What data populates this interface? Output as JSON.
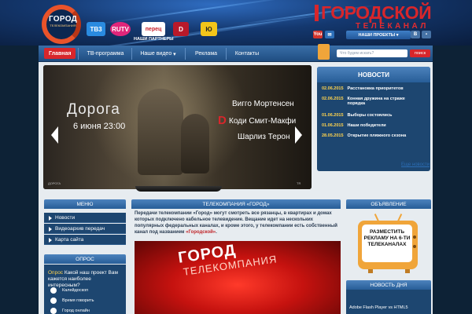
{
  "header": {
    "logo_big": "ГОРОД",
    "logo_small": "ТЕЛЕКОМПАНИЯ",
    "partners_label": "НАШИ ПАРТНЕРЫ",
    "partners": [
      {
        "label": "ТВ3",
        "color": "#2a8be0"
      },
      {
        "label": "RUTV",
        "color": "#e0267a"
      },
      {
        "label": "перец",
        "color": "#c8202a"
      },
      {
        "label": "D",
        "color": "#b8192a"
      },
      {
        "label": "Ю",
        "color": "#f3c51a"
      }
    ],
    "brand_line1": "ГОРОДСКОЙ",
    "brand_line2": "ТЕЛЕКАНАЛ",
    "projects_label": "НАШИ ПРОЕКТЫ",
    "social": [
      {
        "label": "You",
        "color": "#d3342c"
      },
      {
        "label": "✉",
        "color": "#2c6fb8"
      },
      {
        "label": "В",
        "color": "#4773a6"
      }
    ]
  },
  "nav": {
    "items": [
      "Главная",
      "ТВ-программа",
      "Наше видео",
      "Реклама",
      "Контакты"
    ],
    "search_placeholder": "Что будем искать?",
    "search_button": "поиск"
  },
  "slider": {
    "title": "Дорога",
    "date": "6 июня 23:00",
    "letter": "D",
    "cast": [
      "Вигго Мортенсен",
      "Коди Смит-Макфи",
      "Шарлиз Терон"
    ],
    "footer_left": "ДОРОГА",
    "footer_right": "TR"
  },
  "news": {
    "title": "НОВОСТИ",
    "items": [
      {
        "date": "02.06.2015",
        "text": "Расстановка приоритетов"
      },
      {
        "date": "02.06.2015",
        "text": "Конная дружина на страже порядка"
      },
      {
        "date": "01.06.2015",
        "text": "Выборы состоялись"
      },
      {
        "date": "01.06.2015",
        "text": "Наши победители"
      },
      {
        "date": "28.05.2015",
        "text": "Открытие пляжного сезона"
      }
    ],
    "more": "Еще новости"
  },
  "menu": {
    "title": "МЕНЮ",
    "items": [
      "Новости",
      "Видеоархив передач",
      "Карта сайта"
    ]
  },
  "poll": {
    "title": "ОПРОС",
    "label": "Опрос",
    "question": "Какой наш проект Вам кажется наиболее интересным?",
    "options": [
      "Калейдоскоп",
      "Время говорить",
      "Город онлайн"
    ]
  },
  "main": {
    "title": "ТЕЛЕКОМПАНИЯ «ГОРОД»",
    "text": "Передачи телекомпании «Город» могут смотреть все рязанцы, в квартирах и домах которых подключено кабельное телевидение. Вещание идет на нескольких популярных федеральных каналах, и кроме этого, у телекомпании есть собственный канал под названием",
    "link": "«Городской»",
    "tail": ".",
    "video_logo": "ГОРОД",
    "video_sub": "ТЕЛЕКОМПАНИЯ"
  },
  "ad": {
    "title": "ОБЪЯВЛЕНИЕ",
    "text": "РАЗМЕСТИТЬ РЕКЛАМУ НА 6-ТИ ТЕЛЕКАНАЛАХ"
  },
  "day_news": {
    "title": "НОВОСТЬ ДНЯ",
    "text": "Adobe Flash Player vs HTML5"
  }
}
